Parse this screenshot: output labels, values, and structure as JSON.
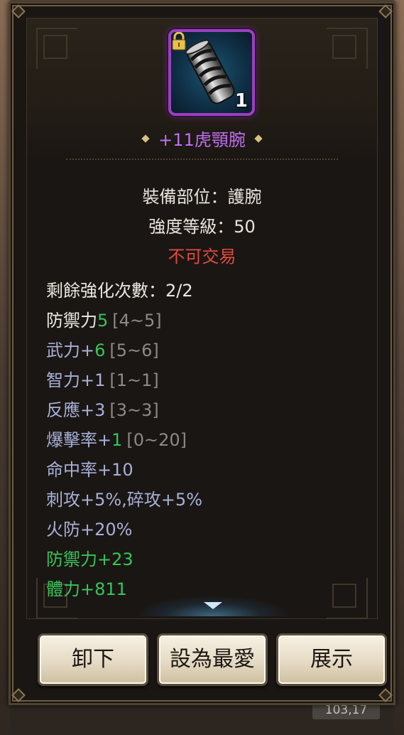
{
  "item": {
    "name": "+11虎顎腕",
    "count": "1",
    "rarity_color": "#c06ef0",
    "icon": "bracer-icon",
    "locked": true
  },
  "info": {
    "slot": "裝備部位：護腕",
    "strength": "強度等級：50",
    "trade": "不可交易"
  },
  "stats": [
    {
      "label": "剩餘強化次數：2/2",
      "value": "",
      "range": ""
    },
    {
      "label": "防禦力",
      "value": "5",
      "range": "[4~5]"
    },
    {
      "label": "武力+",
      "value": "6",
      "range": "[5~6]"
    },
    {
      "label": "智力+1",
      "value": "",
      "range": "[1~1]"
    },
    {
      "label": "反應+3",
      "value": "",
      "range": "[3~3]"
    },
    {
      "label": "爆擊率+",
      "value": "1",
      "range": "[0~20]"
    },
    {
      "label": "命中率+10",
      "value": "",
      "range": ""
    },
    {
      "label": "刺攻+5%,碎攻+5%",
      "value": "",
      "range": ""
    },
    {
      "label": "火防+20%",
      "value": "",
      "range": ""
    },
    {
      "label": "防禦力+23",
      "value": "",
      "range": ""
    },
    {
      "label": "體力+811",
      "value": "",
      "range": ""
    }
  ],
  "buttons": {
    "unequip": "卸下",
    "favorite": "設為最愛",
    "show": "展示"
  },
  "background": {
    "coords": "103,17"
  },
  "colors": {
    "panel_bg": "#1a1613",
    "frame": "#8b7656",
    "stat_blue": "#a8b0d8",
    "stat_green": "#37c45a",
    "untradeable_red": "#e04a3f"
  }
}
